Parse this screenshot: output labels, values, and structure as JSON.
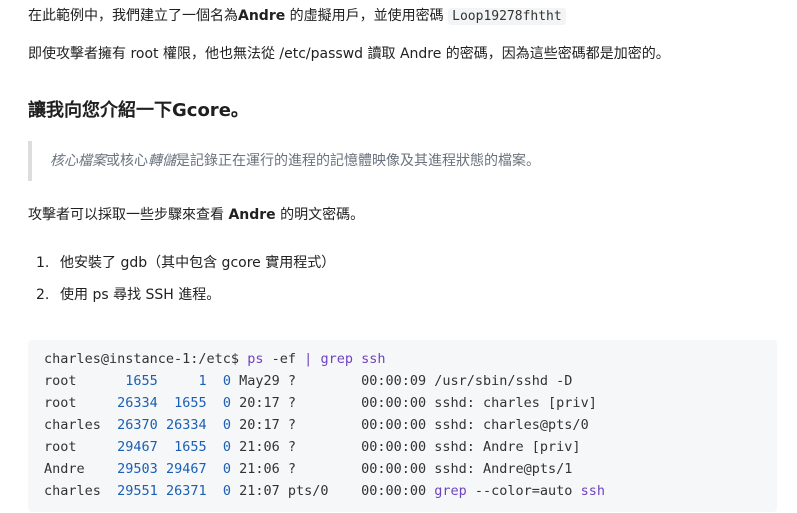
{
  "para1": {
    "before": "在此範例中，我們建立了一個名為",
    "user": "Andre",
    "middle": " 的虛擬用戶，並使用密碼 ",
    "password": "Loop19278fhtht"
  },
  "para2": "即使攻擊者擁有 root 權限，他也無法從 /etc/passwd 讀取 Andre 的密碼，因為這些密碼都是加密的。",
  "heading": {
    "text": "讓我向您介紹一下",
    "bold": "Gcore",
    "end": "。"
  },
  "quote": {
    "term1": "核心檔案",
    "or": "或核心",
    "term2": "轉儲",
    "rest": "是記錄正在運行的進程的記憶體映像及其進程狀態的檔案。"
  },
  "para3": {
    "before": "攻擊者可以採取一些步驟來查看 ",
    "user": "Andre",
    "after": " 的明文密碼。"
  },
  "steps": [
    {
      "num": "1.",
      "text": "他安裝了 gdb（其中包含 gcore 實用程式）"
    },
    {
      "num": "2.",
      "text": "使用 ps 尋找 SSH 進程。"
    }
  ],
  "terminal": {
    "prompt": "charles@instance-1:/etc$",
    "cmd_ps": "ps",
    "arg_ef": "-ef",
    "pipe": "|",
    "cmd_grep": "grep",
    "arg_ssh": "ssh",
    "rows": [
      {
        "user": "root   ",
        "pid": "1655",
        "ppid": "1",
        "c": "0",
        "stime": "May29",
        "tty": "?",
        "time": "00:00:09",
        "cmd": "/usr/sbin/sshd -D"
      },
      {
        "user": "root   ",
        "pid": "26334",
        "ppid": "1655",
        "c": "0",
        "stime": "20:17",
        "tty": "?",
        "time": "00:00:00",
        "cmd": "sshd: charles [priv]"
      },
      {
        "user": "charles",
        "pid": "26370",
        "ppid": "26334",
        "c": "0",
        "stime": "20:17",
        "tty": "?",
        "time": "00:00:00",
        "cmd": "sshd: charles@pts/0"
      },
      {
        "user": "root   ",
        "pid": "29467",
        "ppid": "1655",
        "c": "0",
        "stime": "21:06",
        "tty": "?",
        "time": "00:00:00",
        "cmd": "sshd: Andre [priv]"
      },
      {
        "user": "Andre  ",
        "pid": "29503",
        "ppid": "29467",
        "c": "0",
        "stime": "21:06",
        "tty": "?",
        "time": "00:00:00",
        "cmd": "sshd: Andre@pts/1"
      },
      {
        "user": "charles",
        "pid": "29551",
        "ppid": "26371",
        "c": "0",
        "stime": "21:07",
        "tty": "pts/0",
        "time": "00:00:00",
        "cmd_grep": "grep",
        "cmd_mid": "--color=auto",
        "cmd_ssh": "ssh"
      }
    ]
  }
}
